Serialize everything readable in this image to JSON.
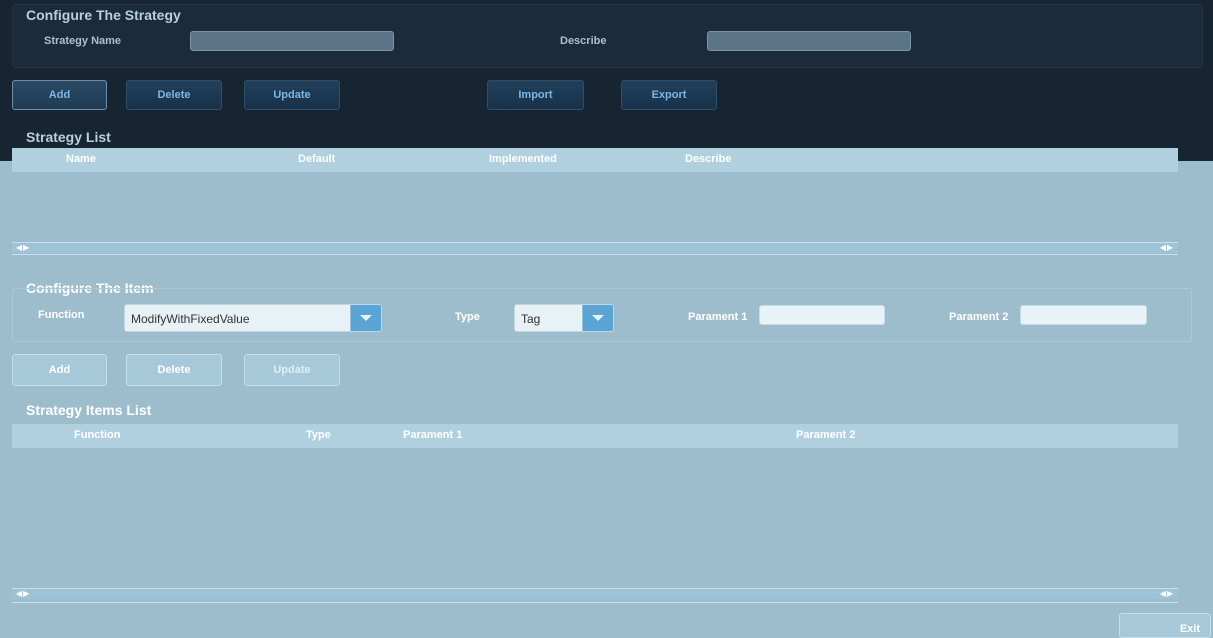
{
  "strategy_config": {
    "title": "Configure The Strategy",
    "name_label": "Strategy Name",
    "name_value": "",
    "describe_label": "Describe",
    "describe_value": ""
  },
  "strategy_buttons": {
    "add": "Add",
    "delete": "Delete",
    "update": "Update",
    "import": "Import",
    "export": "Export"
  },
  "strategy_list": {
    "title": "Strategy List",
    "columns": [
      "Name",
      "Default",
      "Implemented",
      "Describe"
    ],
    "rows": []
  },
  "item_config": {
    "title": "Configure The Item",
    "function_label": "Function",
    "function_value": "ModifyWithFixedValue",
    "type_label": "Type",
    "type_value": "Tag",
    "param1_label": "Parament 1",
    "param1_value": "",
    "param2_label": "Parament 2",
    "param2_value": ""
  },
  "item_buttons": {
    "add": "Add",
    "delete": "Delete",
    "update": "Update"
  },
  "items_list": {
    "title": "Strategy Items List",
    "columns": [
      "Function",
      "Type",
      "Parament 1",
      "Parament 2"
    ],
    "rows": []
  },
  "footer": {
    "exit": "Exit"
  },
  "scroll_arrows": "◀▶",
  "colors": {
    "dark_bg": "#172533",
    "light_bg": "#9dbdcd",
    "header_bg": "#b0d0e0",
    "accent_blue": "#5aa4d6"
  }
}
